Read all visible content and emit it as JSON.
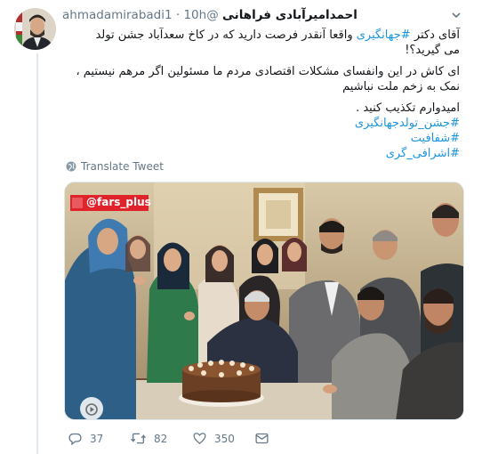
{
  "tweet": {
    "display_name": "احمدامیرآبادی فراهانی",
    "handle": "@ahmadamirabadi1",
    "separator": "·",
    "time": "10h",
    "text": {
      "l1_before": "آقای دکتر ",
      "l1_hashtag": "#جهانگیری",
      "l1_after": " واقعا آنقدر فرصت دارید که در کاخ سعدآباد جشن تولد",
      "l2": "می گیرید؟!",
      "l3": "ای کاش در این وانفسای مشکلات اقتصادی مردم ما مسئولین  اگر مرهم نیستیم ، نمک به زخم ملت نباشیم",
      "l4": "امیدوارم تکذیب کنید ."
    },
    "hashtags": [
      "#جشن_تولدجهانگیری",
      "#شفافیت",
      "#اشرافی_گری"
    ],
    "translate_label": "Translate Tweet",
    "media_watermark": "@fars_plus",
    "counts": {
      "replies": "37",
      "retweets": "82",
      "likes": "350"
    }
  },
  "colors": {
    "link": "#1b95e0",
    "muted": "#657786",
    "border": "#e1e8ed",
    "watermark_bg": "#e0232b"
  },
  "icons": [
    "reply-icon",
    "retweet-icon",
    "like-icon",
    "share-icon",
    "globe-icon",
    "caret-down-icon",
    "play-icon"
  ]
}
